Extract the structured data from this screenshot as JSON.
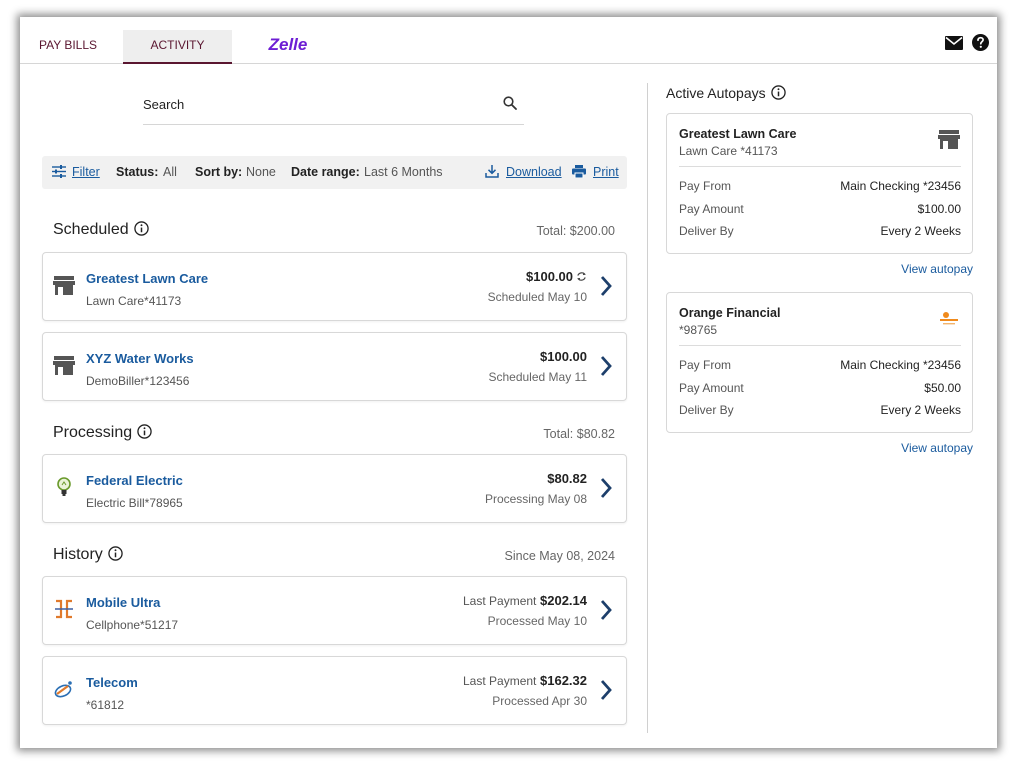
{
  "nav": {
    "tabs": [
      {
        "label": "PAY BILLS"
      },
      {
        "label": "ACTIVITY"
      },
      {
        "label": "Zelle"
      }
    ],
    "active_tab": "ACTIVITY",
    "icons": [
      "mail-icon",
      "help-icon"
    ]
  },
  "search": {
    "placeholder": "Search"
  },
  "filterbar": {
    "filter_label": "Filter",
    "status_label": "Status:",
    "status_value": "All",
    "sort_label": "Sort by:",
    "sort_value": "None",
    "date_label": "Date range:",
    "date_value": "Last 6 Months",
    "download_label": "Download",
    "print_label": "Print"
  },
  "scheduled": {
    "title": "Scheduled",
    "total": "Total: $200.00",
    "items": [
      {
        "name": "Greatest Lawn Care",
        "sub": "Lawn Care*41173",
        "amount": "$100.00",
        "date": "Scheduled May 10",
        "icon": "store-icon",
        "recurring": true
      },
      {
        "name": "XYZ Water Works",
        "sub": "DemoBiller*123456",
        "amount": "$100.00",
        "date": "Scheduled May 11",
        "icon": "store-icon"
      }
    ]
  },
  "processing": {
    "title": "Processing",
    "total": "Total: $80.82",
    "items": [
      {
        "name": "Federal Electric",
        "sub": "Electric Bill*78965",
        "amount": "$80.82",
        "date": "Processing May 08",
        "icon": "lightbulb-icon"
      }
    ]
  },
  "history": {
    "title": "History",
    "since": "Since May 08, 2024",
    "items": [
      {
        "name": "Mobile Ultra",
        "sub": "Cellphone*51217",
        "prefix": "Last Payment",
        "amount": "$202.14",
        "date": "Processed May 10",
        "icon": "mobile-ultra-logo-icon"
      },
      {
        "name": "Telecom",
        "sub": "*61812",
        "prefix": "Last Payment",
        "amount": "$162.32",
        "date": "Processed Apr 30",
        "icon": "telecom-logo-icon"
      }
    ]
  },
  "autopays": {
    "title": "Active Autopays",
    "items": [
      {
        "name": "Greatest Lawn Care",
        "sub": "Lawn Care *41173",
        "pay_from_label": "Pay From",
        "pay_from": "Main Checking *23456",
        "pay_amount_label": "Pay Amount",
        "pay_amount": "$100.00",
        "deliver_by_label": "Deliver By",
        "deliver_by": "Every 2 Weeks",
        "link": "View autopay"
      },
      {
        "name": "Orange Financial",
        "sub": "*98765",
        "pay_from_label": "Pay From",
        "pay_from": "Main Checking *23456",
        "pay_amount_label": "Pay Amount",
        "pay_amount": "$50.00",
        "deliver_by_label": "Deliver By",
        "deliver_by": "Every 2 Weeks",
        "link": "View autopay"
      }
    ]
  },
  "colors": {
    "link": "#1a5b9e",
    "brand": "#5a1630",
    "zelle": "#6d1ed4"
  }
}
